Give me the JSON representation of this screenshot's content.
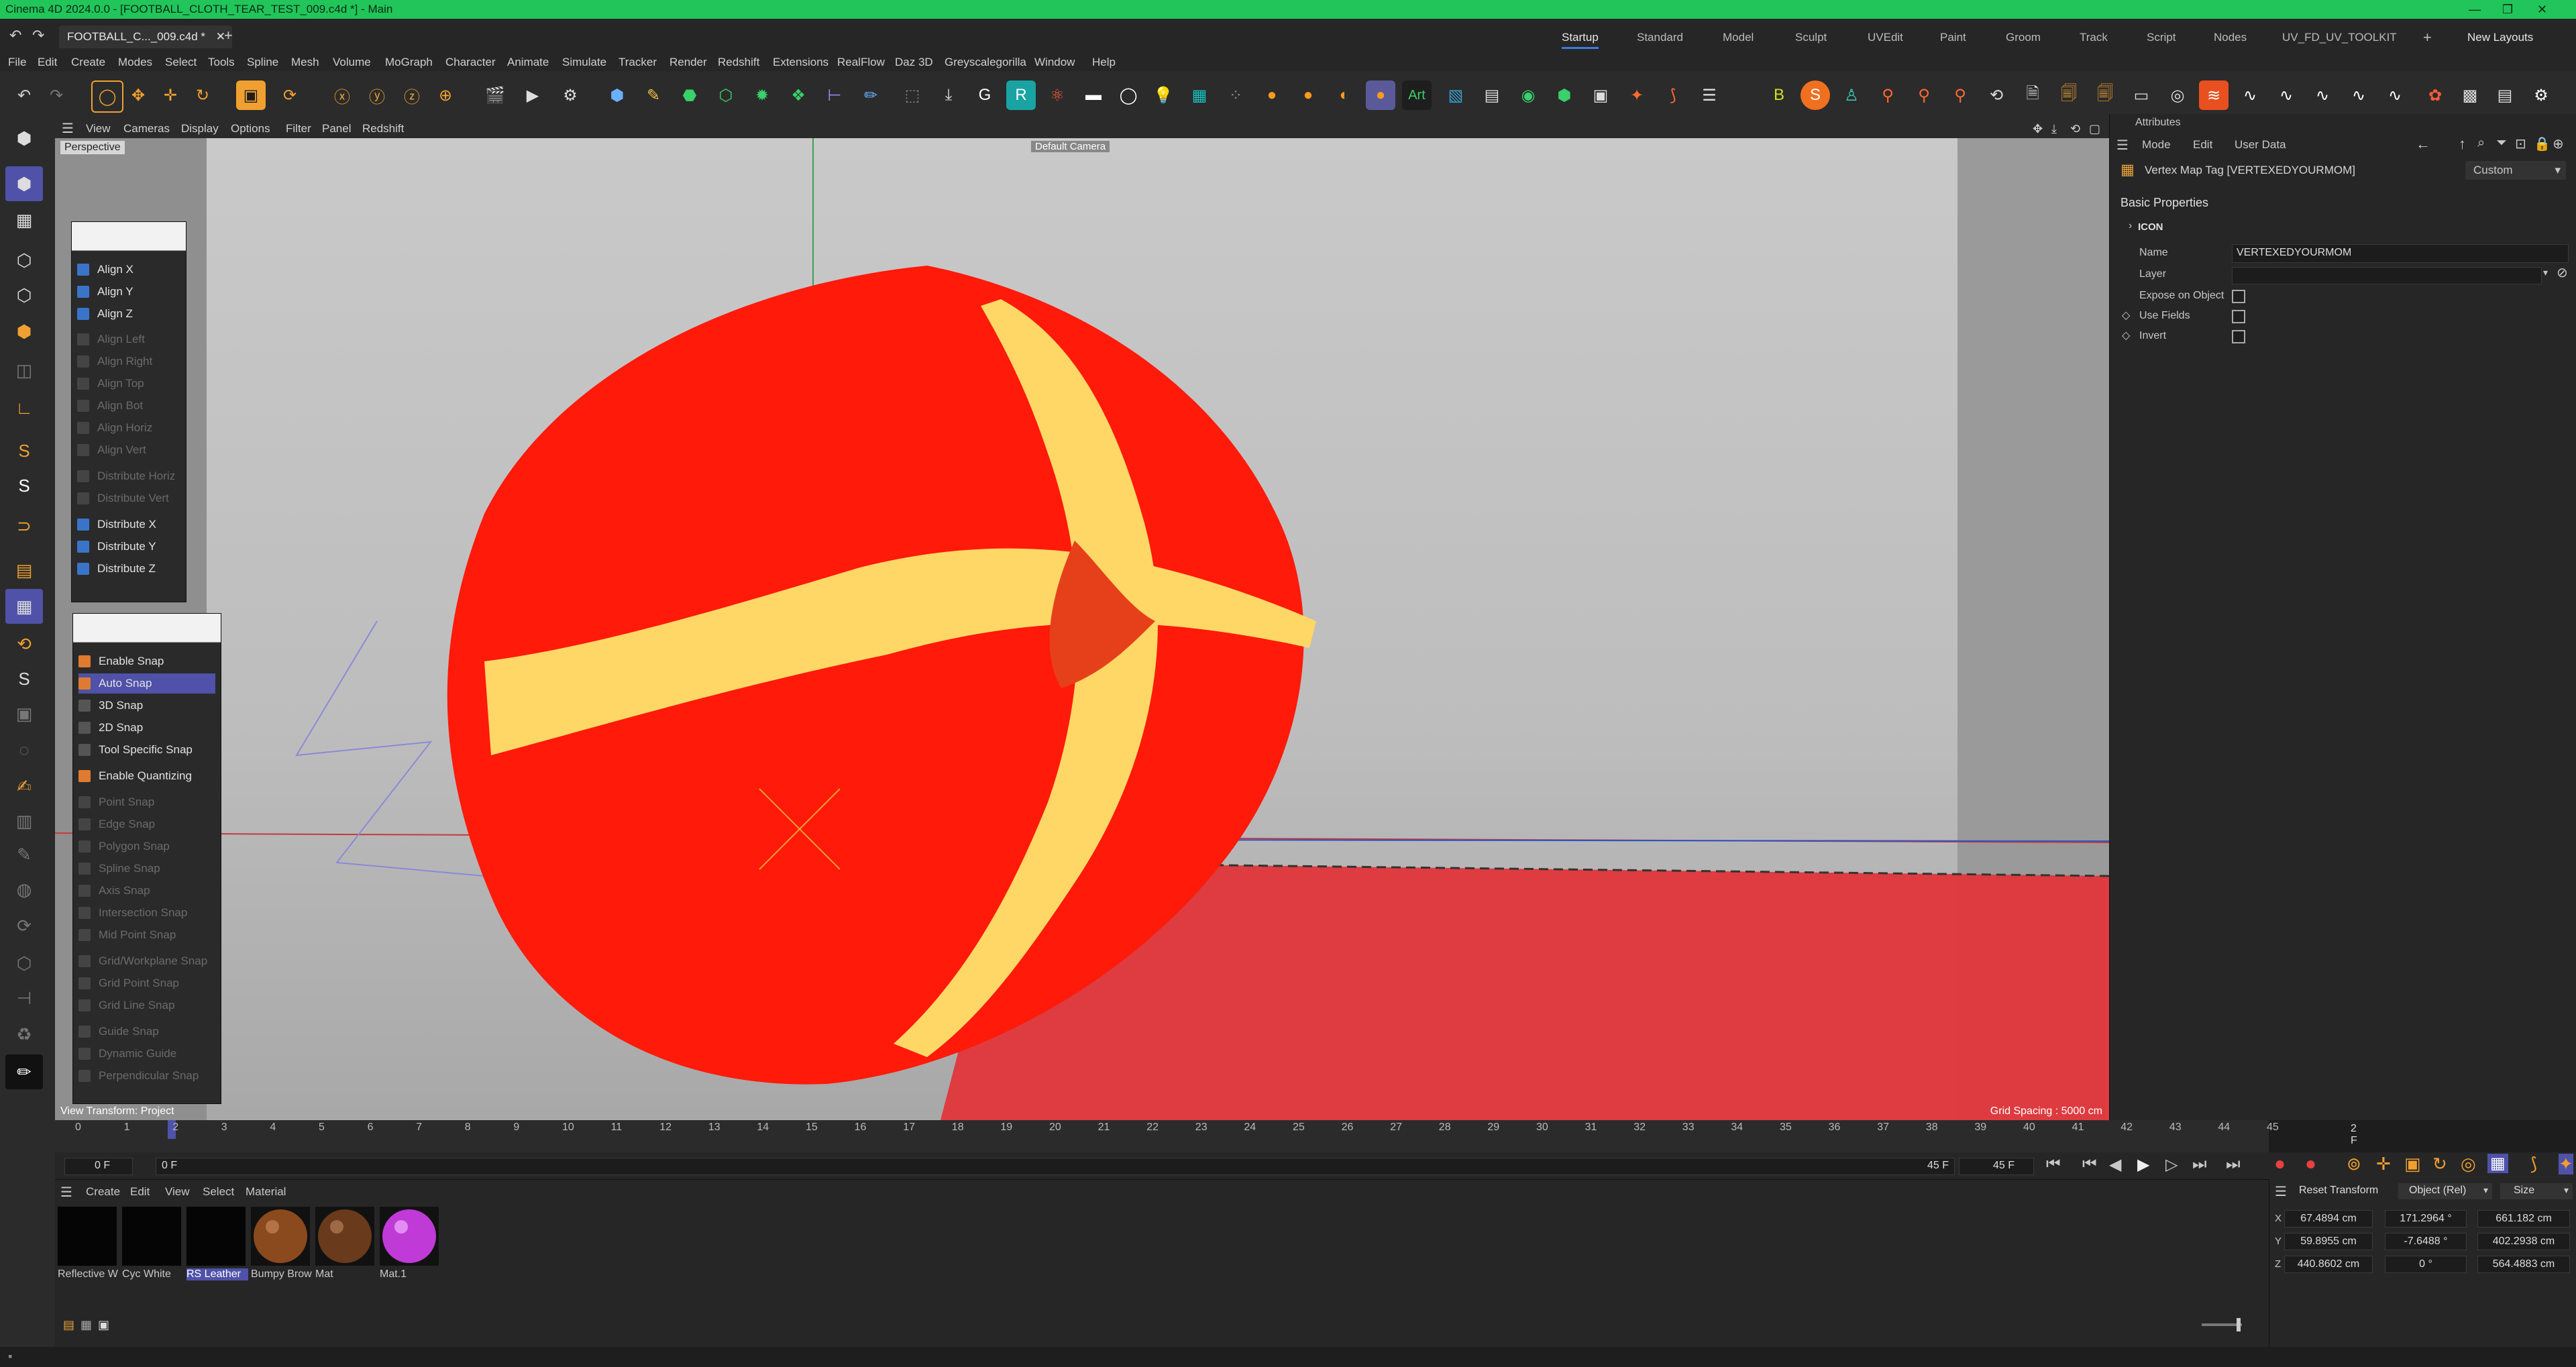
{
  "window": {
    "title": "Cinema 4D 2024.0.0 - [FOOTBALL_CLOTH_TEAR_TEST_009.c4d *] - Main",
    "controls": [
      "—",
      "❐",
      "✕"
    ]
  },
  "doc_tab": {
    "label": "FOOTBALL_C..._009.c4d *",
    "close": "✕",
    "add": "+"
  },
  "layouts": {
    "items": [
      "Startup",
      "Standard",
      "Model",
      "Sculpt",
      "UVEdit",
      "Paint",
      "Groom",
      "Track",
      "Script",
      "Nodes",
      "UV_FD_UV_TOOLKIT"
    ],
    "active": "Startup",
    "add": "+",
    "new_layouts": "New Layouts"
  },
  "menu": [
    "File",
    "Edit",
    "Create",
    "Modes",
    "Select",
    "Tools",
    "Spline",
    "Mesh",
    "Volume",
    "MoGraph",
    "Character",
    "Animate",
    "Simulate",
    "Tracker",
    "Render",
    "Redshift",
    "Extensions",
    "RealFlow",
    "Daz 3D",
    "Greyscalegorilla",
    "Window",
    "Help"
  ],
  "viewport_menu": [
    "View",
    "Cameras",
    "Display",
    "Options",
    "Filter",
    "Panel",
    "Redshift"
  ],
  "viewport": {
    "projection": "Perspective",
    "camera": "Default Camera",
    "transform_mode": "View Transform: Project",
    "grid_spacing": "Grid Spacing : 5000 cm"
  },
  "align_palette": {
    "items": [
      {
        "label": "Align X",
        "enabled": true
      },
      {
        "label": "Align Y",
        "enabled": true
      },
      {
        "label": "Align Z",
        "enabled": true
      },
      {
        "label": "Align Left",
        "enabled": false
      },
      {
        "label": "Align Right",
        "enabled": false
      },
      {
        "label": "Align Top",
        "enabled": false
      },
      {
        "label": "Align Bot",
        "enabled": false
      },
      {
        "label": "Align Horiz",
        "enabled": false
      },
      {
        "label": "Align Vert",
        "enabled": false
      },
      {
        "label": "Distribute Horiz",
        "enabled": false
      },
      {
        "label": "Distribute Vert",
        "enabled": false
      },
      {
        "label": "Distribute X",
        "enabled": true
      },
      {
        "label": "Distribute Y",
        "enabled": true
      },
      {
        "label": "Distribute Z",
        "enabled": true
      }
    ]
  },
  "snap_palette": {
    "items": [
      {
        "label": "Enable Snap",
        "enabled": true
      },
      {
        "label": "Auto Snap",
        "enabled": true,
        "selected": true
      },
      {
        "label": "3D Snap",
        "enabled": true
      },
      {
        "label": "2D Snap",
        "enabled": true
      },
      {
        "label": "Tool Specific Snap",
        "enabled": true
      },
      {
        "label": "Enable Quantizing",
        "enabled": true
      },
      {
        "label": "Point Snap",
        "enabled": false
      },
      {
        "label": "Edge Snap",
        "enabled": false
      },
      {
        "label": "Polygon Snap",
        "enabled": false
      },
      {
        "label": "Spline Snap",
        "enabled": false
      },
      {
        "label": "Axis Snap",
        "enabled": false
      },
      {
        "label": "Intersection Snap",
        "enabled": false
      },
      {
        "label": "Mid Point Snap",
        "enabled": false
      },
      {
        "label": "Grid/Workplane Snap",
        "enabled": false
      },
      {
        "label": "Grid Point Snap",
        "enabled": false
      },
      {
        "label": "Grid Line Snap",
        "enabled": false
      },
      {
        "label": "Guide Snap",
        "enabled": false
      },
      {
        "label": "Dynamic Guide",
        "enabled": false
      },
      {
        "label": "Perpendicular Snap",
        "enabled": false
      }
    ]
  },
  "attributes": {
    "panel_title": "Attributes",
    "menu": [
      "Mode",
      "Edit",
      "User Data"
    ],
    "object_title": "Vertex Map Tag [VERTEXEDYOURMOM]",
    "mode_select": "Custom",
    "section": "Basic Properties",
    "group": "ICON",
    "name_label": "Name",
    "name_value": "VERTEXEDYOURMOM",
    "layer_label": "Layer",
    "expose_label": "Expose on Object",
    "use_fields_label": "Use Fields",
    "invert_label": "Invert"
  },
  "timeline": {
    "ticks": [
      "0",
      "1",
      "2",
      "3",
      "4",
      "5",
      "6",
      "7",
      "8",
      "9",
      "10",
      "11",
      "12",
      "13",
      "14",
      "15",
      "16",
      "17",
      "18",
      "19",
      "20",
      "21",
      "22",
      "23",
      "24",
      "25",
      "26",
      "27",
      "28",
      "29",
      "30",
      "31",
      "32",
      "33",
      "34",
      "35",
      "36",
      "37",
      "38",
      "39",
      "40",
      "41",
      "42",
      "43",
      "44",
      "45"
    ],
    "current_frame": "2 F",
    "start": "0 F",
    "preview_start": "0 F",
    "end": "45 F",
    "preview_end": "45 F"
  },
  "materials": {
    "menu": [
      "Create",
      "Edit",
      "View",
      "Select",
      "Material"
    ],
    "items": [
      {
        "label": "Reflective W",
        "color": "#050505"
      },
      {
        "label": "Cyc White",
        "color": "#050505"
      },
      {
        "label": "RS Leather",
        "color": "#050505",
        "selected": true
      },
      {
        "label": "Bumpy Brow",
        "color": "#8a4a1e"
      },
      {
        "label": "Mat",
        "color": "#6a3a1c"
      },
      {
        "label": "Mat.1",
        "color": "#c03ad8"
      }
    ]
  },
  "coordinates": {
    "reset": "Reset Transform",
    "space": "Object (Rel)",
    "size_mode": "Size",
    "rows": [
      {
        "axis": "X",
        "pos": "67.4894 cm",
        "rot": "171.2964 °",
        "size": "661.182 cm"
      },
      {
        "axis": "Y",
        "pos": "59.8955 cm",
        "rot": "-7.6488 °",
        "size": "402.2938 cm"
      },
      {
        "axis": "Z",
        "pos": "440.8602 cm",
        "rot": "0 °",
        "size": "564.4883 cm"
      }
    ]
  },
  "colors": {
    "title_bar": "#21c55a",
    "ball_red": "#ff1a0a",
    "vertex_yellow": "#ffd766",
    "selection": "#4f52a8"
  }
}
